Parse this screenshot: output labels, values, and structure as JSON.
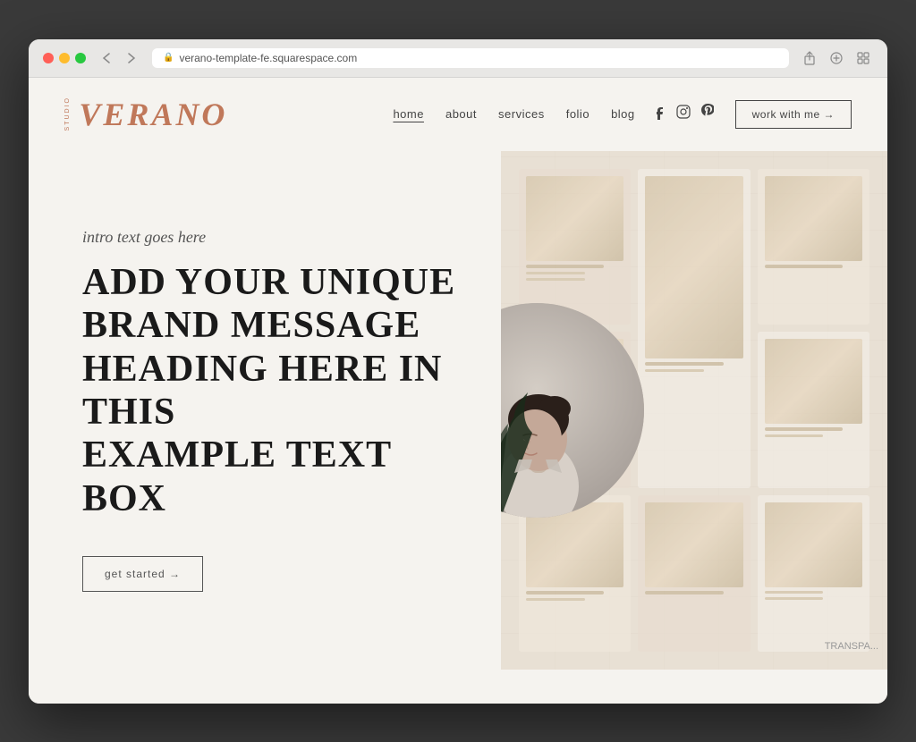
{
  "browser": {
    "url": "verano-template-fe.squarespace.com",
    "reload_label": "⟳"
  },
  "logo": {
    "side_text": "STUDIO",
    "main_text": "VERANO"
  },
  "nav": {
    "links": [
      {
        "label": "home",
        "active": true
      },
      {
        "label": "about",
        "active": false
      },
      {
        "label": "services",
        "active": false
      },
      {
        "label": "folio",
        "active": false
      },
      {
        "label": "blog",
        "active": false
      }
    ],
    "cta_label": "work with me →"
  },
  "hero": {
    "intro_text": "intro text goes here",
    "heading_line1": "ADD YOUR UNIQUE",
    "heading_line2": "BRAND MESSAGE",
    "heading_line3": "HEADING HERE IN THIS",
    "heading_line4": "EXAMPLE TEXT BOX",
    "cta_label": "get started →"
  },
  "footer_watermark": "TRANSPA..."
}
